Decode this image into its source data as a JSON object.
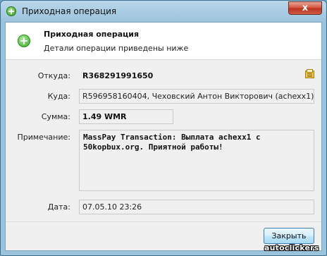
{
  "window": {
    "title": "Приходная операция",
    "close_glyph": "x"
  },
  "header": {
    "title": "Приходная операция",
    "subtitle": "Детали операции приведены ниже",
    "icon": "plus-icon"
  },
  "details": {
    "from_label": "Откуда:",
    "from_value": "R368291991650",
    "to_label": "Куда:",
    "to_value": "R596958160404, Чеховский Антон Викторович (achexx1)",
    "sum_label": "Сумма:",
    "sum_value": "1.49 WMR",
    "note_label": "Примечание:",
    "note_value": "MassPay Transaction: Выплата achexx1 с 50kopbux.org. Приятной работы!",
    "date_label": "Дата:",
    "date_value": "07.05.10 23:26"
  },
  "footer": {
    "close_button": "Закрыть"
  },
  "watermark": "autoclickers",
  "colors": {
    "accent": "#31a021",
    "title_bar": "#9cc3dc",
    "close_button": "#d4543d"
  }
}
